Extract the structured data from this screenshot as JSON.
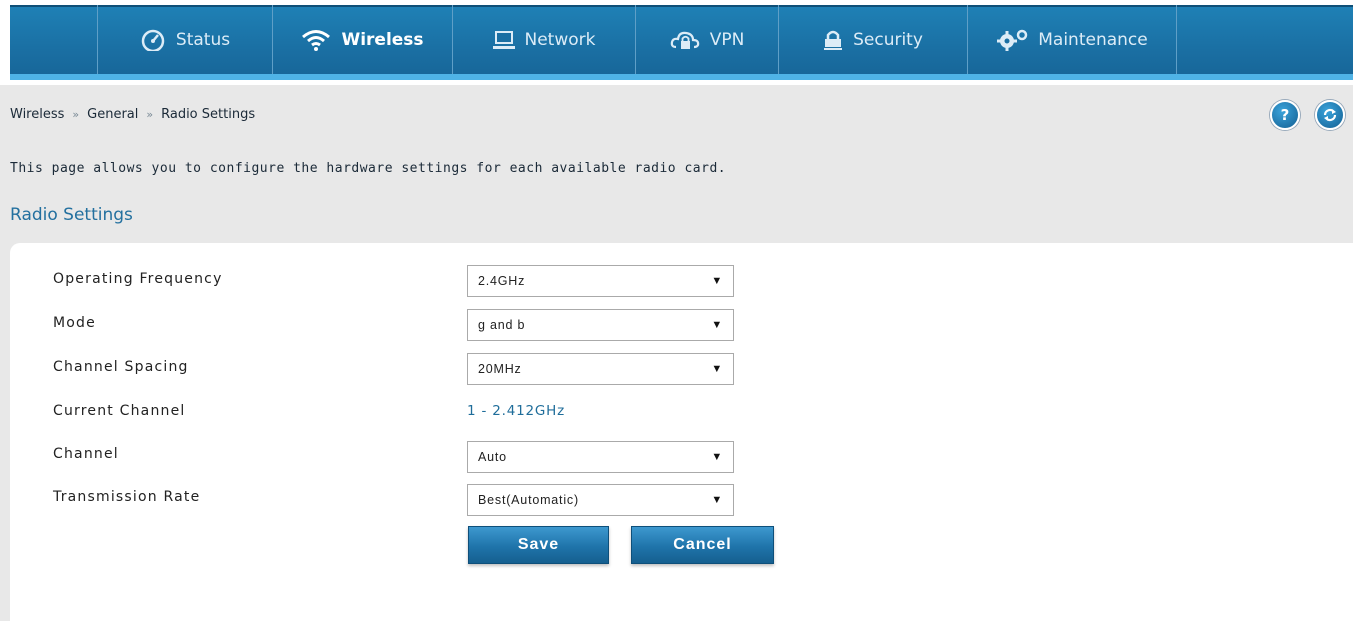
{
  "nav": {
    "items": [
      {
        "label": "Status",
        "icon": "dashboard-icon",
        "active": false
      },
      {
        "label": "Wireless",
        "icon": "wifi-icon",
        "active": true
      },
      {
        "label": "Network",
        "icon": "monitor-icon",
        "active": false
      },
      {
        "label": "VPN",
        "icon": "cloud-lock-icon",
        "active": false
      },
      {
        "label": "Security",
        "icon": "lock-icon",
        "active": false
      },
      {
        "label": "Maintenance",
        "icon": "gears-icon",
        "active": false
      }
    ]
  },
  "breadcrumb": {
    "items": [
      "Wireless",
      "General",
      "Radio Settings"
    ],
    "separator": "»"
  },
  "header_buttons": {
    "help": "?",
    "refresh_icon": "refresh-icon"
  },
  "description": "This page allows you to configure the hardware settings for each available radio card.",
  "section_title": "Radio Settings",
  "form": {
    "operating_frequency": {
      "label": "Operating Frequency",
      "value": "2.4GHz"
    },
    "mode": {
      "label": "Mode",
      "value": "g and b"
    },
    "channel_spacing": {
      "label": "Channel Spacing",
      "value": "20MHz"
    },
    "current_channel": {
      "label": "Current Channel",
      "value": "1 - 2.412GHz"
    },
    "channel": {
      "label": "Channel",
      "value": "Auto"
    },
    "transmission_rate": {
      "label": "Transmission Rate",
      "value": "Best(Automatic)"
    }
  },
  "buttons": {
    "save": "Save",
    "cancel": "Cancel"
  },
  "colors": {
    "nav_bg": "#1a6fa3",
    "nav_accent": "#4fb3e6",
    "section_title": "#23709f",
    "value_text": "#1f6d9a",
    "content_bg": "#e8e8e8"
  }
}
